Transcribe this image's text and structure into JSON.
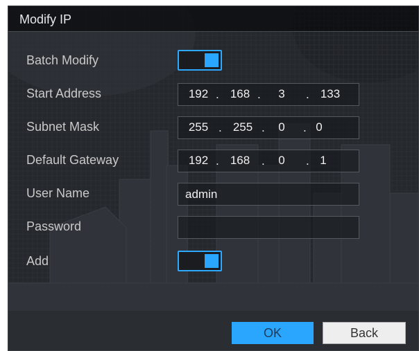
{
  "dialog": {
    "title": "Modify IP"
  },
  "fields": {
    "batch_modify": {
      "label": "Batch Modify",
      "enabled": true
    },
    "start_address": {
      "label": "Start Address",
      "octets": [
        "192",
        "168",
        "3",
        "133"
      ]
    },
    "subnet_mask": {
      "label": "Subnet Mask",
      "octets": [
        "255",
        "255",
        "0",
        "0"
      ]
    },
    "default_gateway": {
      "label": "Default Gateway",
      "octets": [
        "192",
        "168",
        "0",
        "1"
      ]
    },
    "user_name": {
      "label": "User Name",
      "value": "admin"
    },
    "password": {
      "label": "Password",
      "value": ""
    },
    "add": {
      "label": "Add",
      "enabled": true
    }
  },
  "buttons": {
    "ok": "OK",
    "back": "Back"
  },
  "colors": {
    "accent": "#2aa6ff",
    "panel": "#26292e"
  }
}
